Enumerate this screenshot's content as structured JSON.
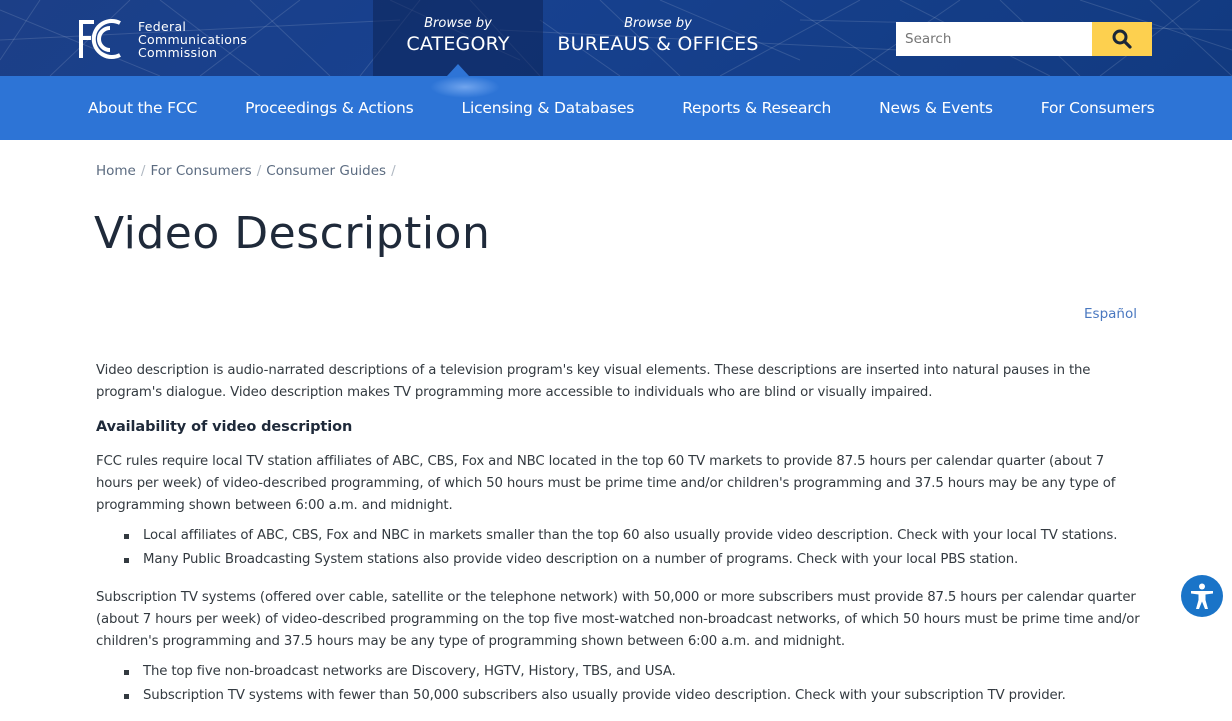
{
  "header": {
    "logo_mark": "FCC",
    "logo_lines": [
      "Federal",
      "Communications",
      "Commission"
    ],
    "browse_category": {
      "small": "Browse by",
      "big": "CATEGORY"
    },
    "browse_bureaus": {
      "small": "Browse by",
      "big": "BUREAUS & OFFICES"
    },
    "search": {
      "placeholder": "Search",
      "value": "",
      "button_icon": "search-icon"
    }
  },
  "nav": {
    "items": [
      {
        "label": "About the FCC"
      },
      {
        "label": "Proceedings & Actions"
      },
      {
        "label": "Licensing & Databases"
      },
      {
        "label": "Reports & Research"
      },
      {
        "label": "News & Events"
      },
      {
        "label": "For Consumers"
      }
    ]
  },
  "breadcrumb": {
    "items": [
      {
        "label": "Home"
      },
      {
        "label": "For Consumers"
      },
      {
        "label": "Consumer Guides"
      }
    ],
    "separator": "/"
  },
  "page": {
    "title": "Video Description",
    "language_link": "Español",
    "intro": "Video description is audio-narrated descriptions of a television program's key visual elements. These descriptions are inserted into natural pauses in the program's dialogue. Video description makes TV programming more accessible to individuals who are blind or visually impaired.",
    "section_heading": "Availability of video description",
    "para_local": "FCC rules require local TV station affiliates of ABC, CBS, Fox and NBC located in the top 60 TV markets to provide 87.5 hours per calendar quarter (about 7 hours per week) of video-described programming, of which 50 hours must be prime time and/or children's programming and 37.5 hours may be any type of programming shown between 6:00 a.m. and midnight.",
    "list_local": [
      "Local affiliates of ABC, CBS, Fox and NBC in markets smaller than the top 60 also usually provide video description. Check with your local TV stations.",
      "Many Public Broadcasting System stations also provide video description on a number of programs. Check with your local PBS station."
    ],
    "para_subscription": "Subscription TV systems (offered over cable, satellite or the telephone network) with 50,000 or more subscribers must provide 87.5 hours per calendar quarter (about 7 hours per week) of video-described programming on the top five most-watched non-broadcast networks, of which 50 hours must be prime time and/or children's programming and 37.5 hours may be any type of programming shown between 6:00 a.m. and midnight.",
    "list_subscription": [
      "The top five non-broadcast networks are Discovery, HGTV, History, TBS, and USA.",
      "Subscription TV systems with fewer than 50,000 subscribers also usually provide video description. Check with your subscription TV provider."
    ]
  },
  "accessibility_widget": {
    "icon": "accessibility-icon"
  },
  "colors": {
    "header_bg": "#17418f",
    "nav_bg": "#2d74d6",
    "search_button": "#fdd04f",
    "link": "#4a78c0",
    "accessibility": "#1a74c8"
  }
}
